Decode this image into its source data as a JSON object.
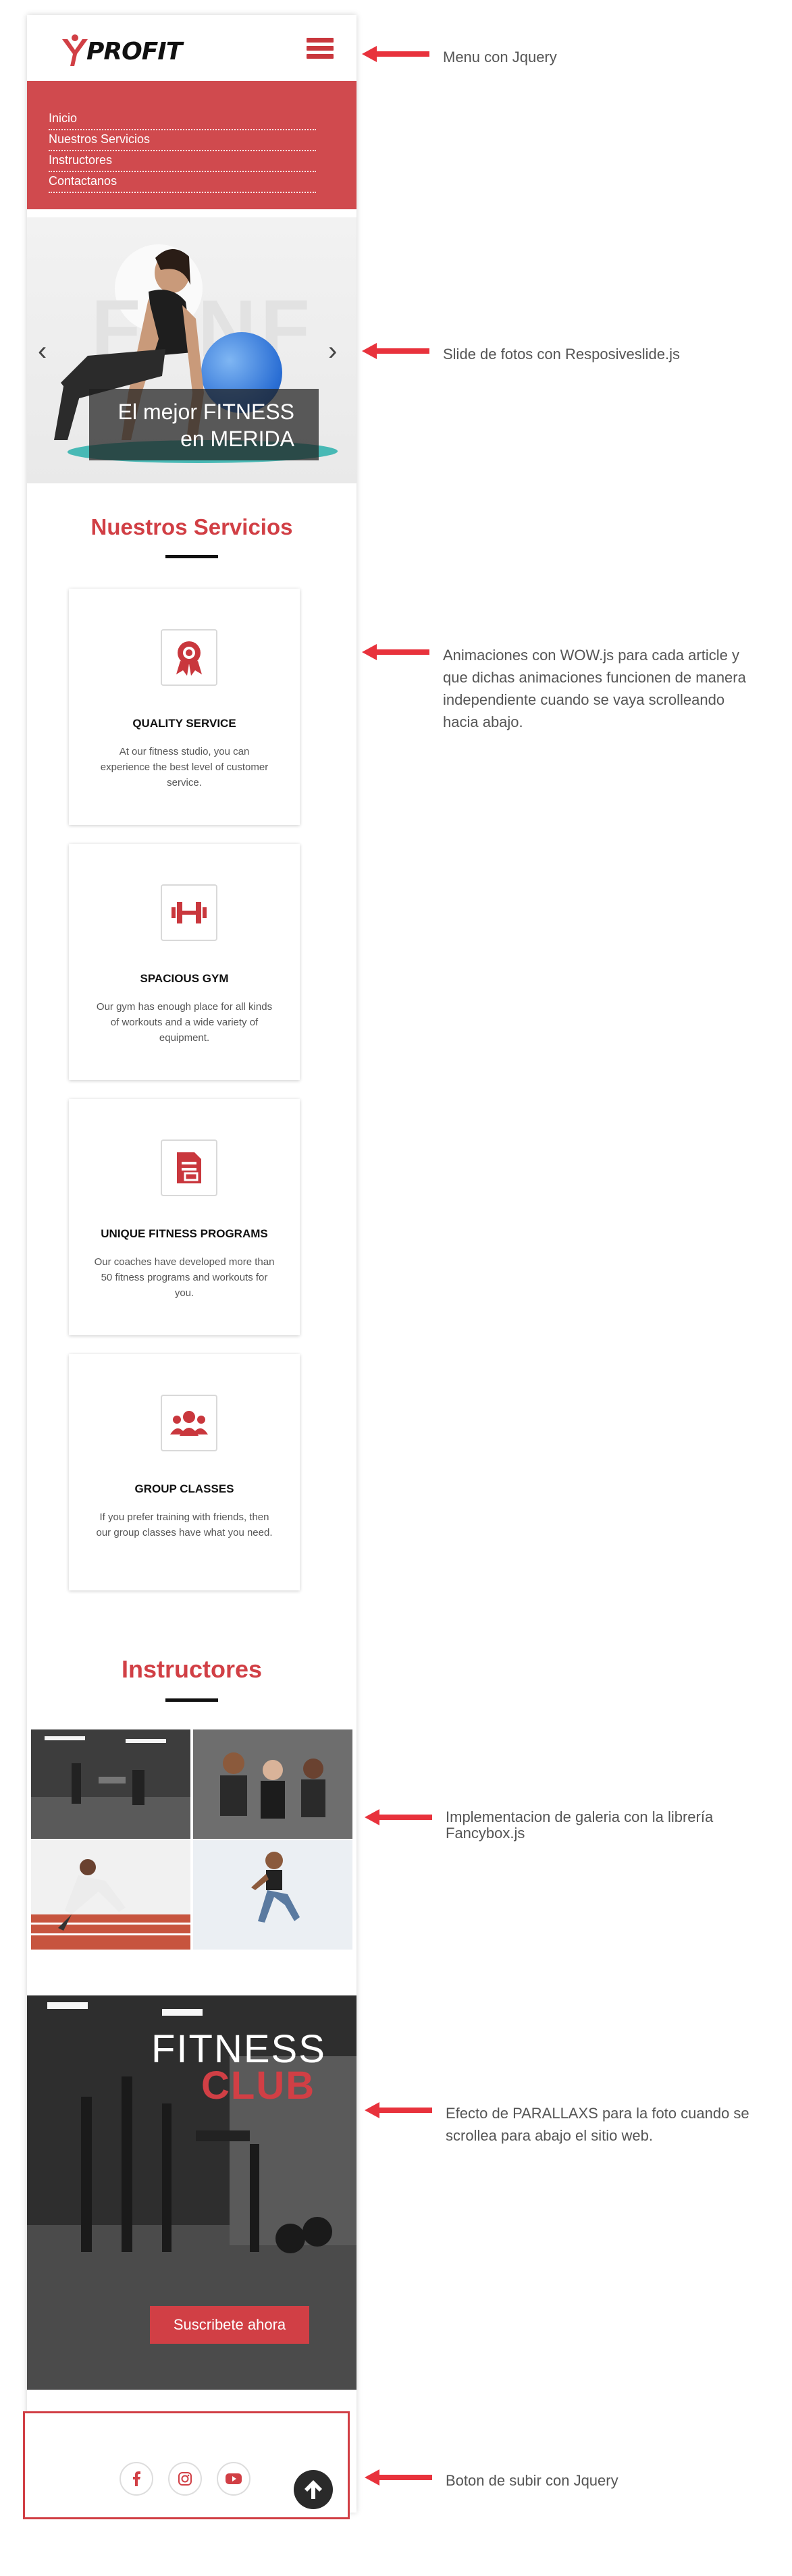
{
  "brand": {
    "name": "PROFIT",
    "accent": "#d13f45"
  },
  "menu": {
    "items": [
      {
        "label": "Inicio"
      },
      {
        "label": "Nuestros Servicios"
      },
      {
        "label": "Instructores"
      },
      {
        "label": "Contactanos"
      }
    ]
  },
  "slider": {
    "caption_line1": "El mejor FITNESS",
    "caption_line2": "en MERIDA",
    "prev_icon": "chevron-left-icon",
    "next_icon": "chevron-right-icon"
  },
  "services": {
    "title": "Nuestros Servicios",
    "items": [
      {
        "name": "QUALITY SERVICE",
        "desc": "At our fitness studio, you can experience the best level of customer service.",
        "icon": "award-icon"
      },
      {
        "name": "SPACIOUS GYM",
        "desc": "Our gym has enough place for all kinds of workouts and a wide variety of equipment.",
        "icon": "dumbbell-icon"
      },
      {
        "name": "UNIQUE FITNESS PROGRAMS",
        "desc": "Our coaches have developed more than 50 fitness programs and workouts for you.",
        "icon": "document-icon"
      },
      {
        "name": "GROUP CLASSES",
        "desc": "If you prefer training with friends, then our group classes have what you need.",
        "icon": "users-icon"
      }
    ]
  },
  "instructors": {
    "title": "Instructores"
  },
  "parallax": {
    "title_line1": "FITNESS",
    "title_line2": "CLUB",
    "button_label": "Suscribete ahora"
  },
  "footer": {
    "social": [
      "facebook-icon",
      "instagram-icon",
      "youtube-icon"
    ],
    "scroll_top_icon": "arrow-up-icon"
  },
  "annotations": [
    "Menu con Jquery",
    "Slide de fotos con Resposiveslide.js",
    "Animaciones con WOW.js para cada article y que dichas animaciones funcionen de manera independiente cuando se vaya scrolleando hacia abajo.",
    "Implementacion de galeria con la librería Fancybox.js",
    "Efecto de PARALLAXS para la foto cuando se scrollea para abajo el sitio web.",
    "Boton de subir con Jquery"
  ]
}
